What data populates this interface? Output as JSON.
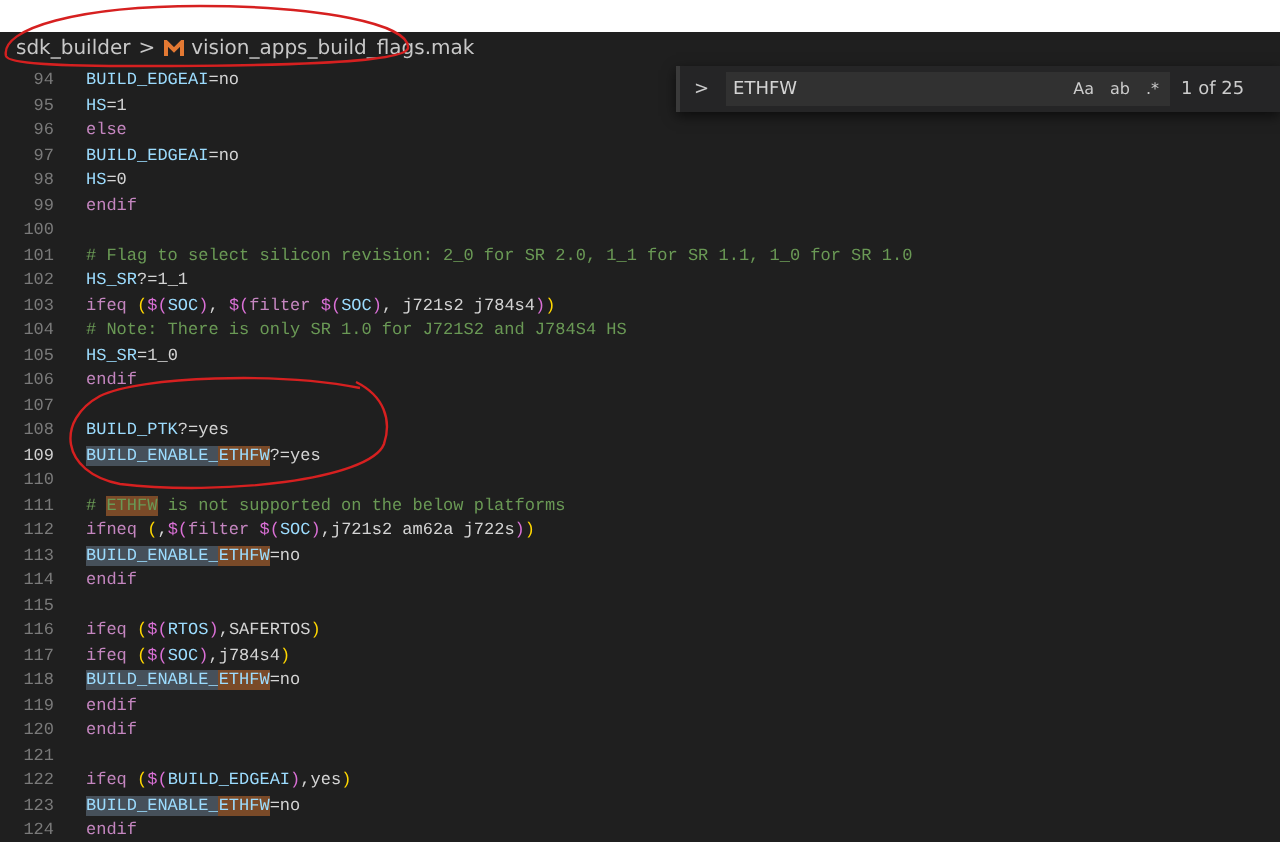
{
  "breadcrumb": {
    "folder": "sdk_builder",
    "separator": ">",
    "file": "vision_apps_build_flags.mak"
  },
  "find": {
    "toggle": ">",
    "value": "ETHFW",
    "options": [
      {
        "label": "Aa",
        "on": false
      },
      {
        "label": "ab",
        "on": false
      },
      {
        "label": ".*",
        "on": false
      }
    ],
    "count": "1 of 25"
  },
  "lines": [
    {
      "number": "94",
      "active": false,
      "tokens": [
        {
          "kind": "var",
          "text": "BUILD_EDGEAI"
        },
        {
          "kind": "plain",
          "text": "=no"
        }
      ]
    },
    {
      "number": "95",
      "active": false,
      "tokens": [
        {
          "kind": "var",
          "text": "HS"
        },
        {
          "kind": "plain",
          "text": "=1"
        }
      ]
    },
    {
      "number": "96",
      "active": false,
      "tokens": [
        {
          "kind": "keyword",
          "text": "else"
        }
      ]
    },
    {
      "number": "97",
      "active": false,
      "tokens": [
        {
          "kind": "var",
          "text": "BUILD_EDGEAI"
        },
        {
          "kind": "plain",
          "text": "=no"
        }
      ]
    },
    {
      "number": "98",
      "active": false,
      "tokens": [
        {
          "kind": "var",
          "text": "HS"
        },
        {
          "kind": "plain",
          "text": "=0"
        }
      ]
    },
    {
      "number": "99",
      "active": false,
      "tokens": [
        {
          "kind": "keyword",
          "text": "endif"
        }
      ]
    },
    {
      "number": "100",
      "active": false
    },
    {
      "number": "101",
      "active": false,
      "tokens": [
        {
          "kind": "comment",
          "text": "# Flag to select silicon revision: 2_0 for SR 2.0, 1_1 for SR 1.1, 1_0 for SR 1.0"
        }
      ]
    },
    {
      "number": "102",
      "active": false,
      "tokens": [
        {
          "kind": "var",
          "text": "HS_SR"
        },
        {
          "kind": "plain",
          "text": "?=1_1"
        }
      ]
    },
    {
      "number": "103",
      "active": false,
      "tokens": [
        {
          "kind": "keyword",
          "text": "ifeq "
        },
        {
          "kind": "bracket",
          "text": "("
        },
        {
          "kind": "paren",
          "text": "$("
        },
        {
          "kind": "var",
          "text": "SOC"
        },
        {
          "kind": "paren",
          "text": ")"
        },
        {
          "kind": "plain",
          "text": ", "
        },
        {
          "kind": "paren",
          "text": "$("
        },
        {
          "kind": "keyword",
          "text": "filter "
        },
        {
          "kind": "paren",
          "text": "$("
        },
        {
          "kind": "var",
          "text": "SOC"
        },
        {
          "kind": "paren",
          "text": ")"
        },
        {
          "kind": "plain",
          "text": ", j721s2 j784s4"
        },
        {
          "kind": "paren",
          "text": ")"
        },
        {
          "kind": "bracket",
          "text": ")"
        }
      ]
    },
    {
      "number": "104",
      "active": false,
      "tokens": [
        {
          "kind": "comment",
          "text": "# Note: There is only SR 1.0 for J721S2 and J784S4 HS"
        }
      ]
    },
    {
      "number": "105",
      "active": false,
      "tokens": [
        {
          "kind": "var",
          "text": "HS_SR"
        },
        {
          "kind": "plain",
          "text": "=1_0"
        }
      ]
    },
    {
      "number": "106",
      "active": false,
      "tokens": [
        {
          "kind": "keyword",
          "text": "endif"
        }
      ]
    },
    {
      "number": "107",
      "active": false
    },
    {
      "number": "108",
      "active": false,
      "tokens": [
        {
          "kind": "var",
          "text": "BUILD_PTK"
        },
        {
          "kind": "plain",
          "text": "?=yes"
        }
      ]
    },
    {
      "number": "109",
      "active": true,
      "tokens": [
        {
          "kind": "hl",
          "text": "BUILD_ENABLE_"
        },
        {
          "kind": "match",
          "text": "ETHFW"
        },
        {
          "kind": "plain",
          "text": "?=yes"
        }
      ]
    },
    {
      "number": "110",
      "active": false
    },
    {
      "number": "111",
      "active": false,
      "tokens": [
        {
          "kind": "comment",
          "text": "# "
        },
        {
          "kind": "commentmatch",
          "text": "ETHFW"
        },
        {
          "kind": "comment",
          "text": " is not supported on the below platforms"
        }
      ]
    },
    {
      "number": "112",
      "active": false,
      "tokens": [
        {
          "kind": "keyword",
          "text": "ifneq "
        },
        {
          "kind": "bracket",
          "text": "("
        },
        {
          "kind": "plain",
          "text": ","
        },
        {
          "kind": "paren",
          "text": "$("
        },
        {
          "kind": "keyword",
          "text": "filter "
        },
        {
          "kind": "paren",
          "text": "$("
        },
        {
          "kind": "var",
          "text": "SOC"
        },
        {
          "kind": "paren",
          "text": ")"
        },
        {
          "kind": "plain",
          "text": ",j721s2 am62a j722s"
        },
        {
          "kind": "paren",
          "text": ")"
        },
        {
          "kind": "bracket",
          "text": ")"
        }
      ]
    },
    {
      "number": "113",
      "active": false,
      "tokens": [
        {
          "kind": "hl",
          "text": "BUILD_ENABLE_"
        },
        {
          "kind": "match",
          "text": "ETHFW"
        },
        {
          "kind": "plain",
          "text": "=no"
        }
      ]
    },
    {
      "number": "114",
      "active": false,
      "tokens": [
        {
          "kind": "keyword",
          "text": "endif"
        }
      ]
    },
    {
      "number": "115",
      "active": false
    },
    {
      "number": "116",
      "active": false,
      "tokens": [
        {
          "kind": "keyword",
          "text": "ifeq "
        },
        {
          "kind": "bracket",
          "text": "("
        },
        {
          "kind": "paren",
          "text": "$("
        },
        {
          "kind": "var",
          "text": "RTOS"
        },
        {
          "kind": "paren",
          "text": ")"
        },
        {
          "kind": "plain",
          "text": ",SAFERTOS"
        },
        {
          "kind": "bracket",
          "text": ")"
        }
      ]
    },
    {
      "number": "117",
      "active": false,
      "tokens": [
        {
          "kind": "keyword",
          "text": "ifeq "
        },
        {
          "kind": "bracket",
          "text": "("
        },
        {
          "kind": "paren",
          "text": "$("
        },
        {
          "kind": "var",
          "text": "SOC"
        },
        {
          "kind": "paren",
          "text": ")"
        },
        {
          "kind": "plain",
          "text": ",j784s4"
        },
        {
          "kind": "bracket",
          "text": ")"
        }
      ]
    },
    {
      "number": "118",
      "active": false,
      "tokens": [
        {
          "kind": "hl",
          "text": "BUILD_ENABLE_"
        },
        {
          "kind": "match",
          "text": "ETHFW"
        },
        {
          "kind": "plain",
          "text": "=no"
        }
      ]
    },
    {
      "number": "119",
      "active": false,
      "tokens": [
        {
          "kind": "keyword",
          "text": "endif"
        }
      ]
    },
    {
      "number": "120",
      "active": false,
      "tokens": [
        {
          "kind": "keyword",
          "text": "endif"
        }
      ]
    },
    {
      "number": "121",
      "active": false
    },
    {
      "number": "122",
      "active": false,
      "tokens": [
        {
          "kind": "keyword",
          "text": "ifeq "
        },
        {
          "kind": "bracket",
          "text": "("
        },
        {
          "kind": "paren",
          "text": "$("
        },
        {
          "kind": "var",
          "text": "BUILD_EDGEAI"
        },
        {
          "kind": "paren",
          "text": ")"
        },
        {
          "kind": "plain",
          "text": ",yes"
        },
        {
          "kind": "bracket",
          "text": ")"
        }
      ]
    },
    {
      "number": "123",
      "active": false,
      "tokens": [
        {
          "kind": "hl",
          "text": "BUILD_ENABLE_"
        },
        {
          "kind": "match",
          "text": "ETHFW"
        },
        {
          "kind": "plain",
          "text": "=no"
        }
      ]
    },
    {
      "number": "124",
      "active": false,
      "tokens": [
        {
          "kind": "keyword",
          "text": "endif"
        }
      ]
    }
  ]
}
